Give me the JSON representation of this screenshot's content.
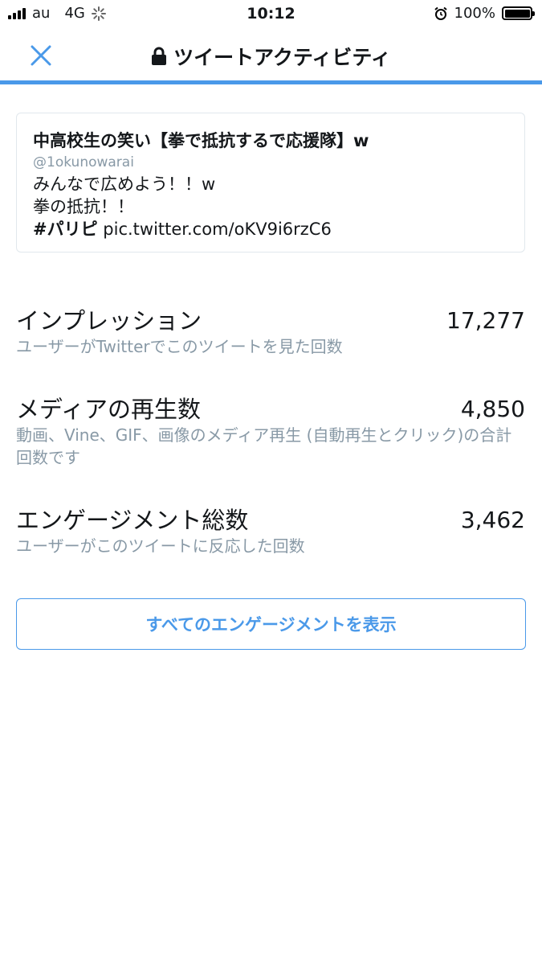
{
  "status_bar": {
    "carrier": "au",
    "network": "4G",
    "time": "10:12",
    "battery": "100%",
    "icons": [
      "signal-icon",
      "loading-spinner-icon",
      "alarm-icon",
      "battery-icon"
    ]
  },
  "header": {
    "title": "ツイートアクティビティ",
    "close_icon": "close-icon",
    "lock_icon": "lock-icon",
    "accent_color": "#4a99e9"
  },
  "tweet": {
    "title": "中高校生の笑い【拳で抵抗するで応援隊】w",
    "handle": "@1okunowarai",
    "line1": "みんなで広めよう！！w",
    "line2": "拳の抵抗！！",
    "hashtag": "#パリピ",
    "link": " pic.twitter.com/oKV9i6rzC6"
  },
  "metrics": [
    {
      "name": "インプレッション",
      "value": "17,277",
      "desc": "ユーザーがTwitterでこのツイートを見た回数"
    },
    {
      "name": "メディアの再生数",
      "value": "4,850",
      "desc": "動画、Vine、GIF、画像のメディア再生 (自動再生とクリック)の合計回数です"
    },
    {
      "name": "エンゲージメント総数",
      "value": "3,462",
      "desc": "ユーザーがこのツイートに反応した回数"
    }
  ],
  "engagements_button": "すべてのエンゲージメントを表示"
}
